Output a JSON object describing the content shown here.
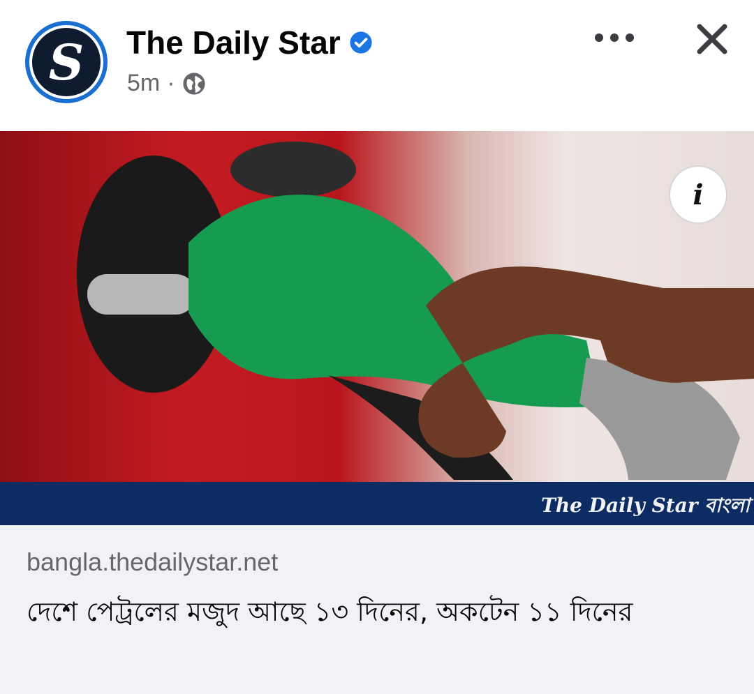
{
  "post": {
    "page_name": "The Daily Star",
    "avatar_letter": "S",
    "time": "5m",
    "separator": "·",
    "verified_icon": "verified-badge-icon",
    "audience_icon": "globe-icon",
    "more_icon": "more-options-icon",
    "close_icon": "close-icon"
  },
  "media": {
    "info_label": "i",
    "watermark": "The Daily Star বাংলা"
  },
  "link": {
    "domain": "bangla.thedailystar.net",
    "headline": "দেশে পেট্রলের মজুদ আছে ১৩ দিনের, অকটেন ১১ দিনের"
  },
  "colors": {
    "accent": "#1b74e4",
    "brand_navy": "#0c2c63",
    "card_bg": "#f0f2f5"
  }
}
